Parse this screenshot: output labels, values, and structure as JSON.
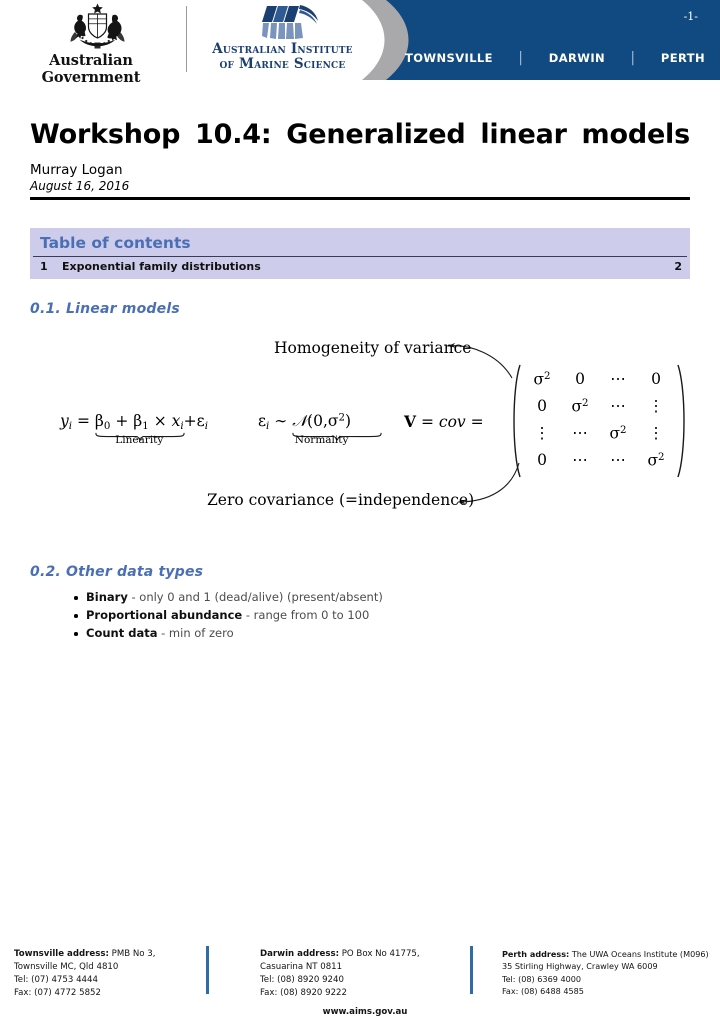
{
  "header": {
    "gov_wordmark": "Australian Government",
    "aims_line1": "Australian Institute",
    "aims_line2": "of Marine Science",
    "page_number": "-1-",
    "cities": [
      "TOWNSVILLE",
      "DARWIN",
      "PERTH"
    ],
    "separator": "|",
    "banner_color": "#114a80",
    "banner_edge_color": "#a9a9ac",
    "aims_blue": "#1b3f73"
  },
  "title_block": {
    "title": "Workshop 10.4: Generalized linear models",
    "author": "Murray Logan",
    "date": "August 16, 2016"
  },
  "toc": {
    "heading": "Table of contents",
    "background": "#cdcdeb",
    "heading_color": "#4a6fb5",
    "entries": [
      {
        "number": "1",
        "label": "Exponential family distributions",
        "page": "2"
      }
    ]
  },
  "sections": {
    "linear_models": {
      "heading": "0.1.  Linear models",
      "color": "#4a6fb5"
    },
    "other_data_types": {
      "heading": "0.2.  Other data types",
      "color": "#4a6fb5"
    }
  },
  "math_figure": {
    "annotation_top": "Homogeneity of variance",
    "annotation_bottom": "Zero covariance (=independence)",
    "equation_linear": {
      "lhs": "y",
      "lhs_sub": "i",
      "equals": "=",
      "term_b0": "β",
      "term_b0_sub": "0",
      "plus": "+",
      "term_b1": "β",
      "term_b1_sub": "1",
      "times": "×",
      "term_x": "x",
      "term_x_sub": "i",
      "error": "ε",
      "error_sub": "i",
      "brace_label": "Linearity"
    },
    "equation_normal": {
      "error": "ε",
      "error_sub": "i",
      "tilde": "∼",
      "dist": "𝒩",
      "args": "(0,σ",
      "args_sup": "2",
      "args_close": ")",
      "brace_label": "Normality"
    },
    "equation_vcov": "V = cov =",
    "matrix": {
      "sigma": "σ",
      "sigma_sup": "2",
      "zero": "0",
      "hdots": "⋯",
      "vdots": "⋮",
      "rows": [
        [
          "sigma",
          "zero",
          "hdots",
          "zero"
        ],
        [
          "zero",
          "sigma",
          "hdots",
          "vdots"
        ],
        [
          "vdots",
          "hdots",
          "sigma",
          "vdots"
        ],
        [
          "zero",
          "hdots",
          "hdots",
          "sigma"
        ]
      ]
    }
  },
  "bullets": [
    {
      "term": "Binary",
      "detail": " - only 0 and 1 (dead/alive) (present/absent)"
    },
    {
      "term": "Proportional abundance",
      "detail": " - range from 0 to 100"
    },
    {
      "term": "Count data",
      "detail": " - min of zero"
    }
  ],
  "footer": {
    "townsville": {
      "label": "Townsville address:",
      "line1": " PMB No 3,",
      "line2": "Townsville MC, Qld 4810",
      "line3": "Tel: (07) 4753 4444",
      "line4": "Fax: (07) 4772 5852"
    },
    "darwin": {
      "label": "Darwin address:",
      "line1": " PO Box No 41775,",
      "line2": "Casuarina NT 0811",
      "line3": "Tel: (08) 8920 9240",
      "line4": "Fax: (08) 8920 9222"
    },
    "perth": {
      "label": "Perth address:",
      "line1": " The UWA Oceans Institute (M096)",
      "line2": "35 Stirling Highway, Crawley WA 6009",
      "line3": "Tel: (08) 6369 4000",
      "line4": "Fax: (08) 6488 4585"
    },
    "website": "www.aims.gov.au",
    "separator_color": "#2e6ca4"
  }
}
